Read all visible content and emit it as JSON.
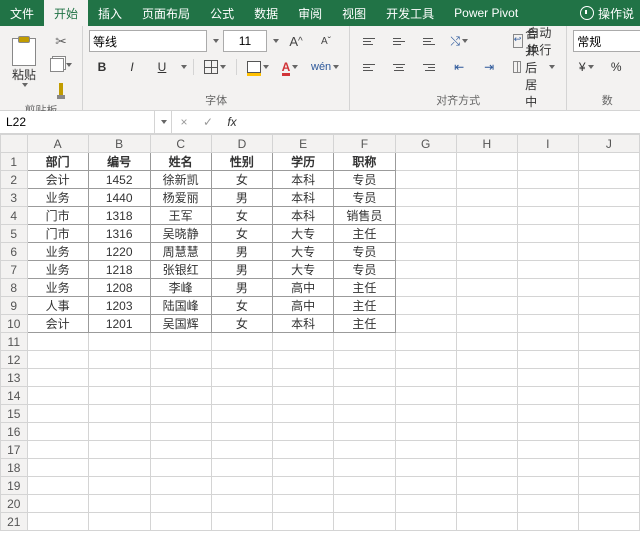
{
  "tabs": [
    "文件",
    "开始",
    "插入",
    "页面布局",
    "公式",
    "数据",
    "审阅",
    "视图",
    "开发工具",
    "Power Pivot"
  ],
  "active_tab": 1,
  "tell_me": "操作说",
  "ribbon": {
    "clipboard": {
      "paste": "粘贴",
      "label": "剪贴板"
    },
    "font": {
      "name": "等线",
      "size": "11",
      "label": "字体",
      "bold": "B",
      "italic": "I",
      "underline": "U",
      "grow": "A",
      "shrink": "A"
    },
    "align": {
      "wrap": "自动换行",
      "merge": "合并后居中",
      "label": "对齐方式"
    },
    "number": {
      "format": "常规",
      "label": "数",
      "percent": "%"
    }
  },
  "namebox": "L22",
  "formula": "",
  "columns": [
    "A",
    "B",
    "C",
    "D",
    "E",
    "F",
    "G",
    "H",
    "I",
    "J"
  ],
  "row_count": 21,
  "table": {
    "headers": [
      "部门",
      "编号",
      "姓名",
      "性别",
      "学历",
      "职称"
    ],
    "rows": [
      [
        "会计",
        "1452",
        "徐新凯",
        "女",
        "本科",
        "专员"
      ],
      [
        "业务",
        "1440",
        "杨爱丽",
        "男",
        "本科",
        "专员"
      ],
      [
        "门市",
        "1318",
        "王军",
        "女",
        "本科",
        "销售员"
      ],
      [
        "门市",
        "1316",
        "吴晓静",
        "女",
        "大专",
        "主任"
      ],
      [
        "业务",
        "1220",
        "周慧慧",
        "男",
        "大专",
        "专员"
      ],
      [
        "业务",
        "1218",
        "张银红",
        "男",
        "大专",
        "专员"
      ],
      [
        "业务",
        "1208",
        "李峰",
        "男",
        "高中",
        "主任"
      ],
      [
        "人事",
        "1203",
        "陆国峰",
        "女",
        "高中",
        "主任"
      ],
      [
        "会计",
        "1201",
        "吴国辉",
        "女",
        "本科",
        "主任"
      ]
    ]
  }
}
